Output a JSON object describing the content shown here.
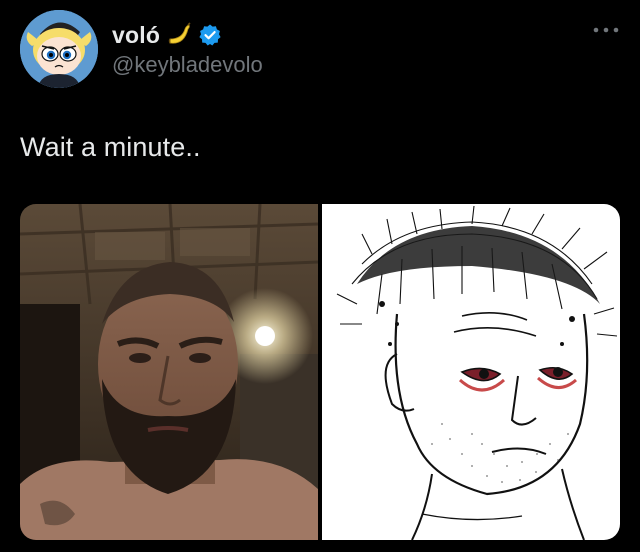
{
  "author": {
    "display_name": "voló",
    "handle": "@keybladevolo",
    "verified": true,
    "name_emoji": "banana-icon",
    "avatar": "powerpuff-avatar"
  },
  "tweet": {
    "text": "Wait a minute..",
    "media": [
      {
        "kind": "photo",
        "depicts": "bearded-man-selfie"
      },
      {
        "kind": "drawing",
        "depicts": "wojak-sketch"
      }
    ]
  },
  "menu": {
    "more_icon": "more-dots-icon"
  },
  "colors": {
    "background": "#000000",
    "text": "#e7e9ea",
    "secondary_text": "#71767b",
    "verified": "#1d9bf0",
    "banana": "#f5d033"
  }
}
